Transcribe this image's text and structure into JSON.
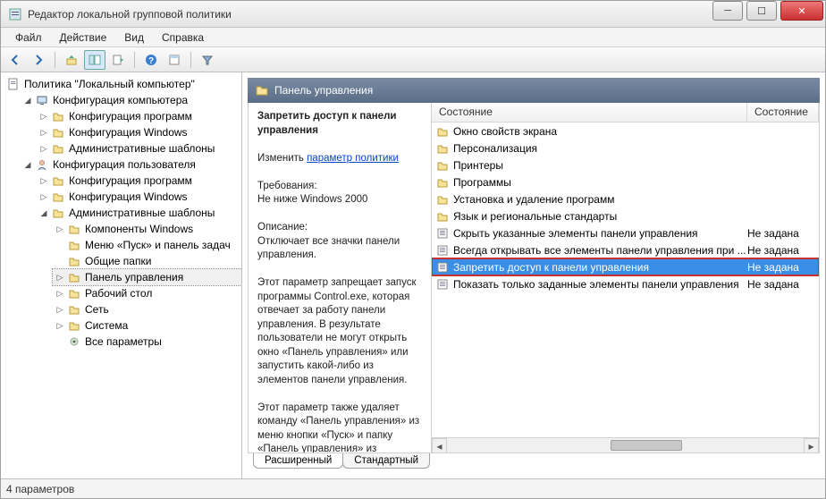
{
  "window": {
    "title": "Редактор локальной групповой политики"
  },
  "menus": {
    "file": "Файл",
    "action": "Действие",
    "view": "Вид",
    "help": "Справка"
  },
  "tree": {
    "root": "Политика \"Локальный компьютер\"",
    "comp_config": "Конфигурация компьютера",
    "comp_progs": "Конфигурация программ",
    "comp_windows": "Конфигурация Windows",
    "comp_admin": "Административные шаблоны",
    "user_config": "Конфигурация пользователя",
    "user_progs": "Конфигурация программ",
    "user_windows": "Конфигурация Windows",
    "user_admin": "Административные шаблоны",
    "admin_components": "Компоненты Windows",
    "admin_startmenu": "Меню «Пуск» и панель задач",
    "admin_shared": "Общие папки",
    "admin_controlpanel": "Панель управления",
    "admin_desktop": "Рабочий стол",
    "admin_network": "Сеть",
    "admin_system": "Система",
    "admin_allparams": "Все параметры"
  },
  "right_header": {
    "title": "Панель управления"
  },
  "desc": {
    "title": "Запретить доступ к панели управления",
    "edit_prefix": "Изменить ",
    "edit_link": "параметр политики",
    "req_label": "Требования:",
    "req_value": "Не ниже Windows 2000",
    "desc_label": "Описание:",
    "desc_text1": "Отключает все значки панели управления.",
    "desc_text2": "Этот параметр запрещает запуск программы Control.exe, которая отвечает за работу панели управления. В результате пользователи не могут открыть окно «Панель управления» или запустить какой-либо из элементов панели управления.",
    "desc_text3": "Этот параметр также удаляет команду «Панель управления» из меню кнопки «Пуск» и папку «Панель управления» из"
  },
  "columns": {
    "name": "Состояние",
    "state": "Состояние"
  },
  "items": [
    {
      "type": "folder",
      "name": "Окно свойств экрана",
      "state": ""
    },
    {
      "type": "folder",
      "name": "Персонализация",
      "state": ""
    },
    {
      "type": "folder",
      "name": "Принтеры",
      "state": ""
    },
    {
      "type": "folder",
      "name": "Программы",
      "state": ""
    },
    {
      "type": "folder",
      "name": "Установка и удаление программ",
      "state": ""
    },
    {
      "type": "folder",
      "name": "Язык и региональные стандарты",
      "state": ""
    },
    {
      "type": "setting",
      "name": "Скрыть указанные элементы панели управления",
      "state": "Не задана"
    },
    {
      "type": "setting",
      "name": "Всегда открывать все элементы панели управления при ...",
      "state": "Не задана"
    },
    {
      "type": "setting",
      "name": "Запретить доступ к панели управления",
      "state": "Не задана",
      "selected": true
    },
    {
      "type": "setting",
      "name": "Показать только заданные элементы панели управления",
      "state": "Не задана"
    }
  ],
  "tabs": {
    "extended": "Расширенный",
    "standard": "Стандартный"
  },
  "status": {
    "text": "4 параметров"
  }
}
